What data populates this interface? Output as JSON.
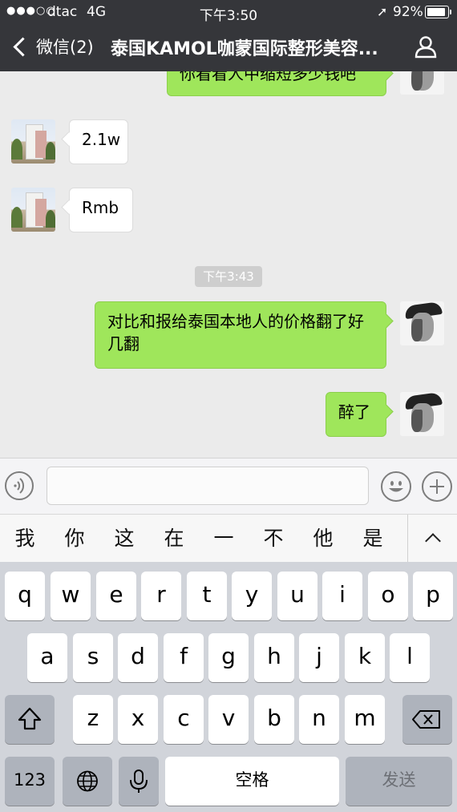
{
  "status": {
    "carrier": "dtac",
    "network": "4G",
    "time": "下午3:50",
    "battery": "92%"
  },
  "nav": {
    "back_label": "微信(2)",
    "title": "泰国KAMOL咖蒙国际整形美容..."
  },
  "chat": {
    "messages": [
      {
        "side": "out",
        "text": "你看看人中缩短多少钱吧"
      },
      {
        "side": "in",
        "text": "2.1w"
      },
      {
        "side": "in",
        "text": "Rmb"
      },
      {
        "side": "out",
        "text": "对比和报给泰国本地人的价格翻了好几翻"
      },
      {
        "side": "out",
        "text": "醉了"
      }
    ],
    "timestamp": "下午3:43"
  },
  "candidates": [
    "我",
    "你",
    "这",
    "在",
    "一",
    "不",
    "他",
    "是"
  ],
  "keyboard": {
    "row1": [
      "q",
      "w",
      "e",
      "r",
      "t",
      "y",
      "u",
      "i",
      "o",
      "p"
    ],
    "row2": [
      "a",
      "s",
      "d",
      "f",
      "g",
      "h",
      "j",
      "k",
      "l"
    ],
    "row3": [
      "z",
      "x",
      "c",
      "v",
      "b",
      "n",
      "m"
    ],
    "num_label": "123",
    "space_label": "空格",
    "send_label": "发送"
  },
  "icons": {
    "back": "chevron-left-icon",
    "contact": "person-icon",
    "voice": "voice-icon",
    "emoji": "emoji-icon",
    "more": "plus-icon",
    "expand": "chevron-up-icon",
    "shift": "shift-icon",
    "backspace": "backspace-icon",
    "globe": "globe-icon",
    "mic": "microphone-icon"
  },
  "colors": {
    "nav_bg": "#35363a",
    "chat_bg": "#ebebeb",
    "outgoing_bubble": "#9fe65b",
    "incoming_bubble": "#ffffff"
  }
}
